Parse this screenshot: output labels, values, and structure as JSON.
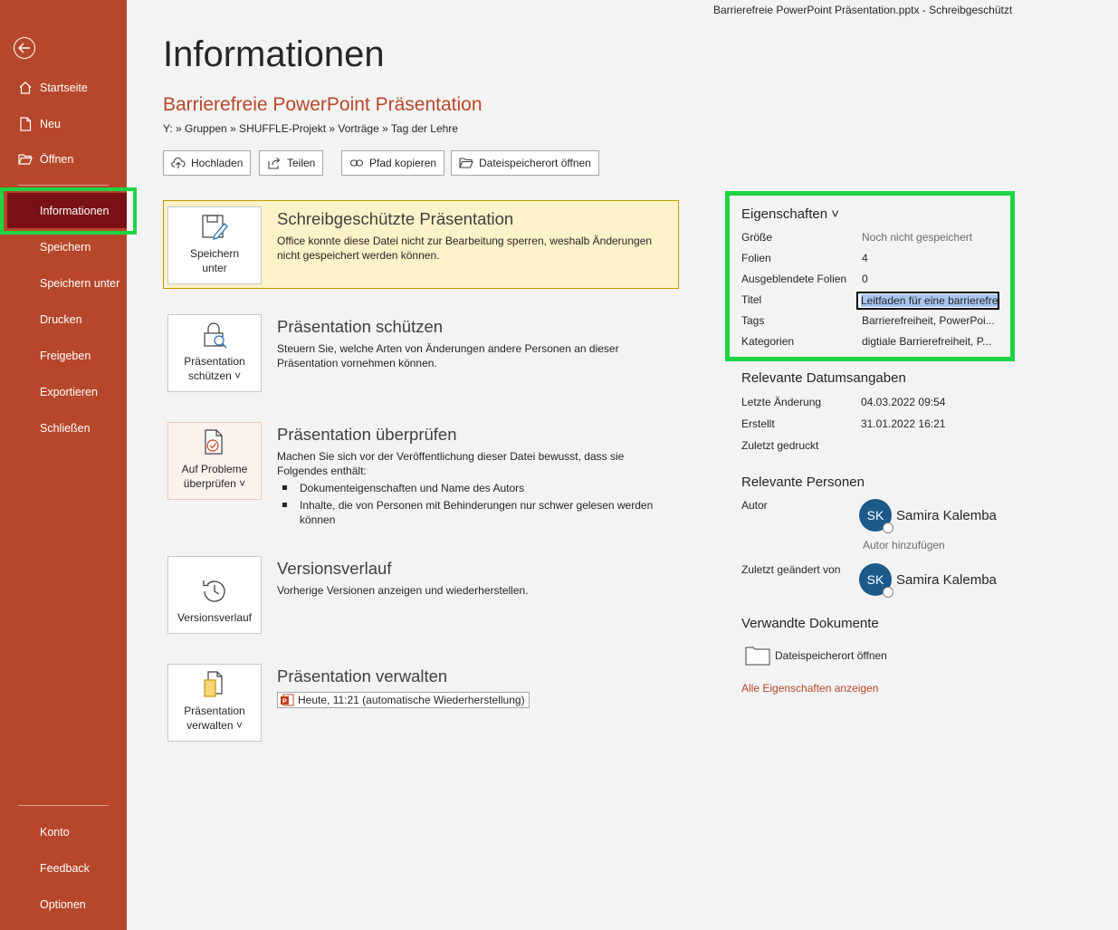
{
  "window": {
    "title": "Barrierefreie PowerPoint Präsentation.pptx  -  Schreibgeschützt"
  },
  "sidebar": {
    "back_icon": "back-arrow-icon",
    "items": [
      {
        "label": "Startseite",
        "icon": "home-icon"
      },
      {
        "label": "Neu",
        "icon": "new-document-icon"
      },
      {
        "label": "Öffnen",
        "icon": "open-folder-icon"
      },
      {
        "label": "Informationen"
      },
      {
        "label": "Speichern"
      },
      {
        "label": "Speichern unter"
      },
      {
        "label": "Drucken"
      },
      {
        "label": "Freigeben"
      },
      {
        "label": "Exportieren"
      },
      {
        "label": "Schließen"
      }
    ],
    "footer": [
      {
        "label": "Konto"
      },
      {
        "label": "Feedback"
      },
      {
        "label": "Optionen"
      }
    ],
    "colors": {
      "background": "#b7472a",
      "active": "#7a1115",
      "highlight_border": "#1ed443"
    }
  },
  "main": {
    "page_title": "Informationen",
    "doc_title": "Barrierefreie PowerPoint Präsentation",
    "path": "Y: » Gruppen » SHUFFLE-Projekt » Vorträge » Tag der Lehre",
    "toolbar": {
      "upload": "Hochladen",
      "share": "Teilen",
      "copy_path": "Pfad kopieren",
      "open_location": "Dateispeicherort öffnen"
    },
    "sections": {
      "readonly": {
        "button_line1": "Speichern",
        "button_line2": "unter",
        "title": "Schreibgeschützte Präsentation",
        "desc": "Office konnte diese Datei nicht zur Bearbeitung sperren, weshalb Änderungen nicht gespeichert werden können."
      },
      "protect": {
        "button_line1": "Präsentation",
        "button_line2": "schützen ˅",
        "title": "Präsentation schützen",
        "desc": "Steuern Sie, welche Arten von Änderungen andere Personen an dieser Präsentation vornehmen können."
      },
      "inspect": {
        "button_line1": "Auf Probleme",
        "button_line2": "überprüfen ˅",
        "title": "Präsentation überprüfen",
        "desc": "Machen Sie sich vor der Veröffentlichung dieser Datei bewusst, dass sie Folgendes enthält:",
        "bullets": [
          "Dokumenteigenschaften und Name des Autors",
          "Inhalte, die von Personen mit Behinderungen nur schwer gelesen werden können"
        ]
      },
      "versions": {
        "button_line1": "Versionsverlauf",
        "title": "Versionsverlauf",
        "desc": "Vorherige Versionen anzeigen und wiederherstellen."
      },
      "manage": {
        "button_line1": "Präsentation",
        "button_line2": "verwalten ˅",
        "title": "Präsentation verwalten",
        "version_entry": "Heute, 11:21 (automatische Wiederherstellung)"
      }
    }
  },
  "properties": {
    "heading": "Eigenschaften ˅",
    "rows": [
      {
        "key": "Größe",
        "value": "Noch nicht gespeichert"
      },
      {
        "key": "Folien",
        "value": "4"
      },
      {
        "key": "Ausgeblendete Folien",
        "value": "0"
      },
      {
        "key": "Titel",
        "value": "Leitfaden für eine barrierefre"
      },
      {
        "key": "Tags",
        "value": "Barrierefreiheit, PowerPoi..."
      },
      {
        "key": "Kategorien",
        "value": "digtiale Barrierefreiheit, P..."
      }
    ]
  },
  "dates": {
    "heading": "Relevante Datumsangaben",
    "rows": [
      {
        "key": "Letzte Änderung",
        "value": "04.03.2022 09:54"
      },
      {
        "key": "Erstellt",
        "value": "31.01.2022 16:21"
      },
      {
        "key": "Zuletzt gedruckt",
        "value": ""
      }
    ]
  },
  "people": {
    "heading": "Relevante Personen",
    "author_label": "Autor",
    "author_initials": "SK",
    "author_name": "Samira Kalemba",
    "add_author": "Autor hinzufügen",
    "modified_label": "Zuletzt geändert von",
    "modified_initials": "SK",
    "modified_name": "Samira Kalemba"
  },
  "related": {
    "heading": "Verwandte Dokumente",
    "open_location": "Dateispeicherort öffnen",
    "all_properties": "Alle Eigenschaften anzeigen"
  }
}
